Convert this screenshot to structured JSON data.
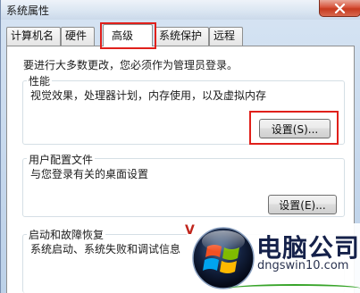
{
  "window": {
    "title": "系统属性",
    "close_icon": "close-icon"
  },
  "tabs": [
    {
      "label": "计算机名"
    },
    {
      "label": "硬件"
    },
    {
      "label": "高级",
      "active": true
    },
    {
      "label": "系统保护"
    },
    {
      "label": "远程"
    }
  ],
  "intro": "要进行大多数更改，您必须作为管理员登录。",
  "performance": {
    "title": "性能",
    "description": "视觉效果，处理器计划，内存使用，以及虚拟内存",
    "button": "设置(S)..."
  },
  "user_profiles": {
    "title": "用户配置文件",
    "description": "与您登录有关的桌面设置",
    "button": "设置(E)..."
  },
  "startup_recovery": {
    "title": "启动和故障恢复",
    "description": "系统启动、系统失败和调试信息"
  },
  "watermark": {
    "brand": "电脑公司",
    "url": "dngswin10.com",
    "logo_icon": "windows-logo-icon",
    "colors": {
      "highlight": "#e0201b",
      "brand": "#15214a"
    }
  }
}
